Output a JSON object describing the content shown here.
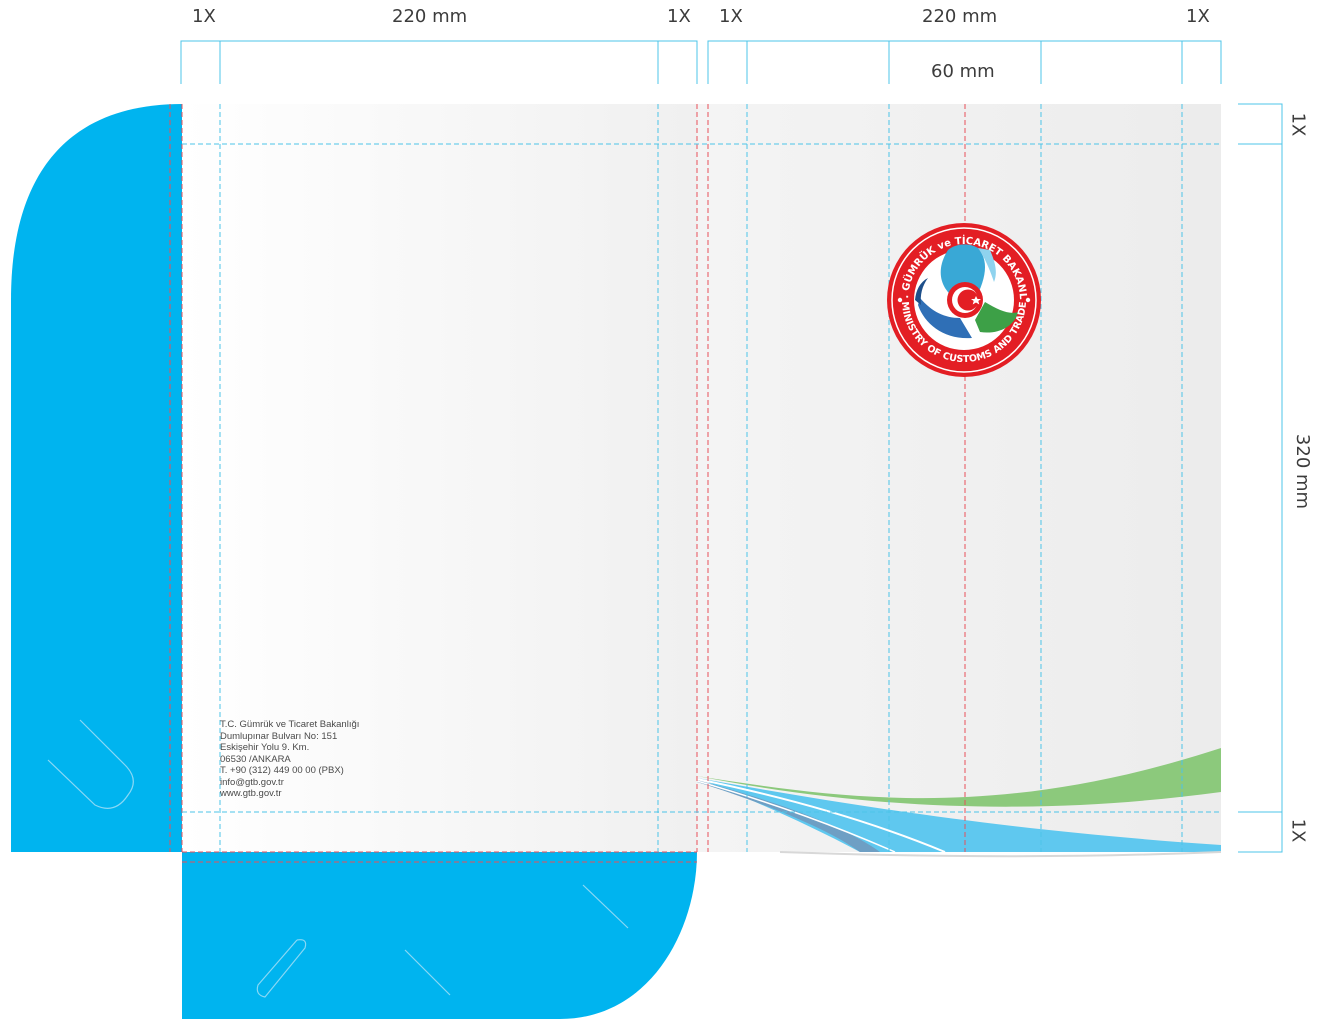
{
  "dimensions": {
    "top_left": {
      "margin_left": "1X",
      "width": "220 mm",
      "margin_right": "1X"
    },
    "top_right": {
      "margin_left": "1X",
      "width": "220 mm",
      "margin_right": "1X",
      "spine": "60 mm"
    },
    "right": {
      "top": "1X",
      "height": "320 mm",
      "bottom": "1X"
    }
  },
  "address": {
    "lines": [
      "T.C. Gümrük ve Ticaret Bakanlığı",
      "Dumlupınar Bulvarı No: 151",
      "Eskişehir Yolu 9. Km.",
      "06530 /ANKARA",
      "T. +90 (312) 449 00 00 (PBX)",
      "info@gtb.gov.tr",
      "www.gtb.gov.tr"
    ]
  },
  "logo": {
    "top_text": "T.C. GÜMRÜK ve TİCARET BAKANLIĞI",
    "bottom_text": "MINISTRY OF CUSTOMS AND TRADE"
  },
  "colors": {
    "flap_blue": "#00b4ef",
    "guide_cyan": "#4cc4e8",
    "bleed_red": "#e8505a",
    "seal_red": "#e31e24",
    "wave_green": "#8cc97c",
    "wave_blue": "#5fc8ef"
  }
}
